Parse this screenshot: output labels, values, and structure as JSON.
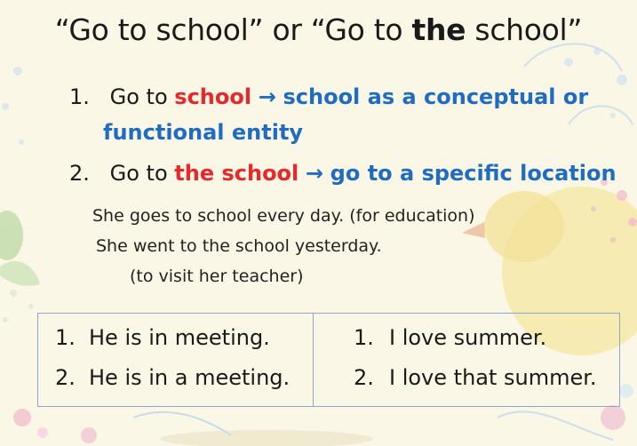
{
  "title": {
    "part1": "“Go to school” or “Go to ",
    "bold": "the",
    "part2": " school”"
  },
  "points": [
    {
      "number": "1.",
      "prefix": "Go to ",
      "highlight": "school",
      "arrow": "→",
      "meaning_line1": "school as a conceptual or",
      "meaning_line2": "functional entity"
    },
    {
      "number": "2.",
      "prefix": "Go to ",
      "highlight": "the school",
      "arrow": "→",
      "meaning": "go to a specific location"
    }
  ],
  "examples": [
    "She goes to school every day. (for education)",
    "She went to the school yesterday.",
    "(to visit her teacher)"
  ],
  "table": {
    "left": [
      {
        "number": "1.",
        "text": "He is in meeting."
      },
      {
        "number": "2.",
        "text": "He is in a meeting."
      }
    ],
    "right": [
      {
        "number": "1.",
        "text": "I love summer."
      },
      {
        "number": "2.",
        "text": "I love that summer."
      }
    ]
  },
  "colors": {
    "highlight_red": "#e8282b",
    "meaning_blue": "#1f6dc2",
    "table_border": "#8fa5cf",
    "background": "#fbf7e6"
  }
}
